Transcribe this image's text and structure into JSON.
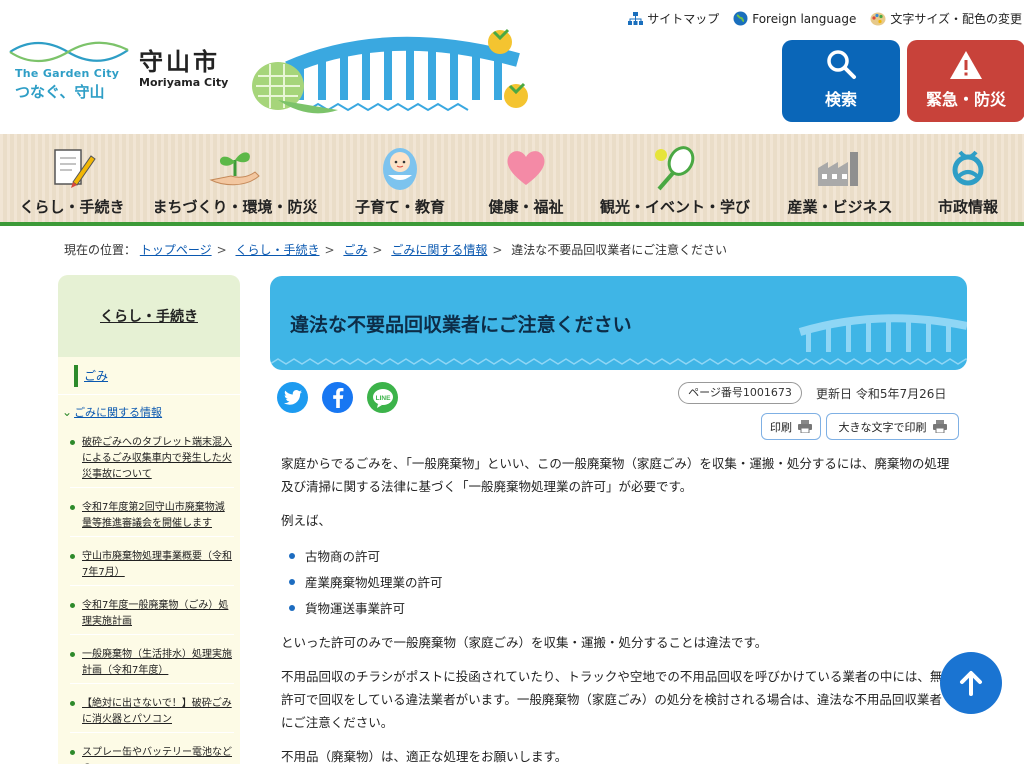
{
  "utility": {
    "sitemap": "サイトマップ",
    "foreign": "Foreign language",
    "font_color": "文字サイズ・配色の変更"
  },
  "logo": {
    "tagline_en": "The Garden City",
    "tagline_jp": "つなぐ、守山",
    "city_name": "守山市",
    "city_name_en": "Moriyama City"
  },
  "header_buttons": {
    "search": "検索",
    "emergency": "緊急・防災",
    "search_color": "#0a66b8",
    "emergency_color": "#c8423a"
  },
  "global_nav": [
    {
      "label": "くらし・手続き",
      "icon": "document-pen-icon"
    },
    {
      "label": "まちづくり・環境・防災",
      "icon": "sprout-hand-icon"
    },
    {
      "label": "子育て・教育",
      "icon": "baby-icon"
    },
    {
      "label": "健康・福祉",
      "icon": "heart-icon"
    },
    {
      "label": "観光・イベント・学び",
      "icon": "tennis-racket-icon"
    },
    {
      "label": "産業・ビジネス",
      "icon": "factory-icon"
    },
    {
      "label": "市政情報",
      "icon": "city-emblem-icon"
    }
  ],
  "breadcrumb": {
    "prefix": "現在の位置：",
    "items": [
      "トップページ",
      "くらし・手続き",
      "ごみ",
      "ごみに関する情報"
    ],
    "current": "違法な不要品回収業者にご注意ください"
  },
  "sidebar": {
    "heading": "くらし・手続き",
    "current": "ごみ",
    "sub_heading": "ごみに関する情報",
    "links": [
      "破砕ごみへのタブレット端末混入によるごみ収集車内で発生した火災事故について",
      "令和7年度第2回守山市廃棄物減量等推進審議会を開催します",
      "守山市廃棄物処理事業概要（令和7年7月）",
      "令和7年度一般廃棄物（ごみ）処理実施計画",
      "一般廃棄物（生活排水）処理実施計画（令和7年度）",
      "【絶対に出さないで！】破砕ごみに消火器とパソコン",
      "スプレー缶やバッテリー電池などの"
    ]
  },
  "page": {
    "title": "違法な不要品回収業者にご注意ください",
    "page_number": "ページ番号1001673",
    "updated": "更新日 令和5年7月26日",
    "print": "印刷",
    "print_large": "大きな文字で印刷",
    "social": [
      "twitter-icon",
      "facebook-icon",
      "line-icon"
    ]
  },
  "content": {
    "p1": "家庭からでるごみを、「一般廃棄物」といい、この一般廃棄物（家庭ごみ）を収集・運搬・処分するには、廃棄物の処理及び清掃に関する法律に基づく「一般廃棄物処理業の許可」が必要です。",
    "p2": "例えば、",
    "list": [
      "古物商の許可",
      "産業廃棄物処理業の許可",
      "貨物運送事業許可"
    ],
    "p3": "といった許可のみで一般廃棄物（家庭ごみ）を収集・運搬・処分することは違法です。",
    "p4": "不用品回収のチラシがポストに投函されていたり、トラックや空地での不用品回収を呼びかけている業者の中には、無許可で回収をしている違法業者がいます。一般廃棄物（家庭ごみ）の処分を検討される場合は、違法な不用品回収業者にご注意ください。",
    "p5": "不用品（廃棄物）は、適正な処理をお願いします。"
  }
}
